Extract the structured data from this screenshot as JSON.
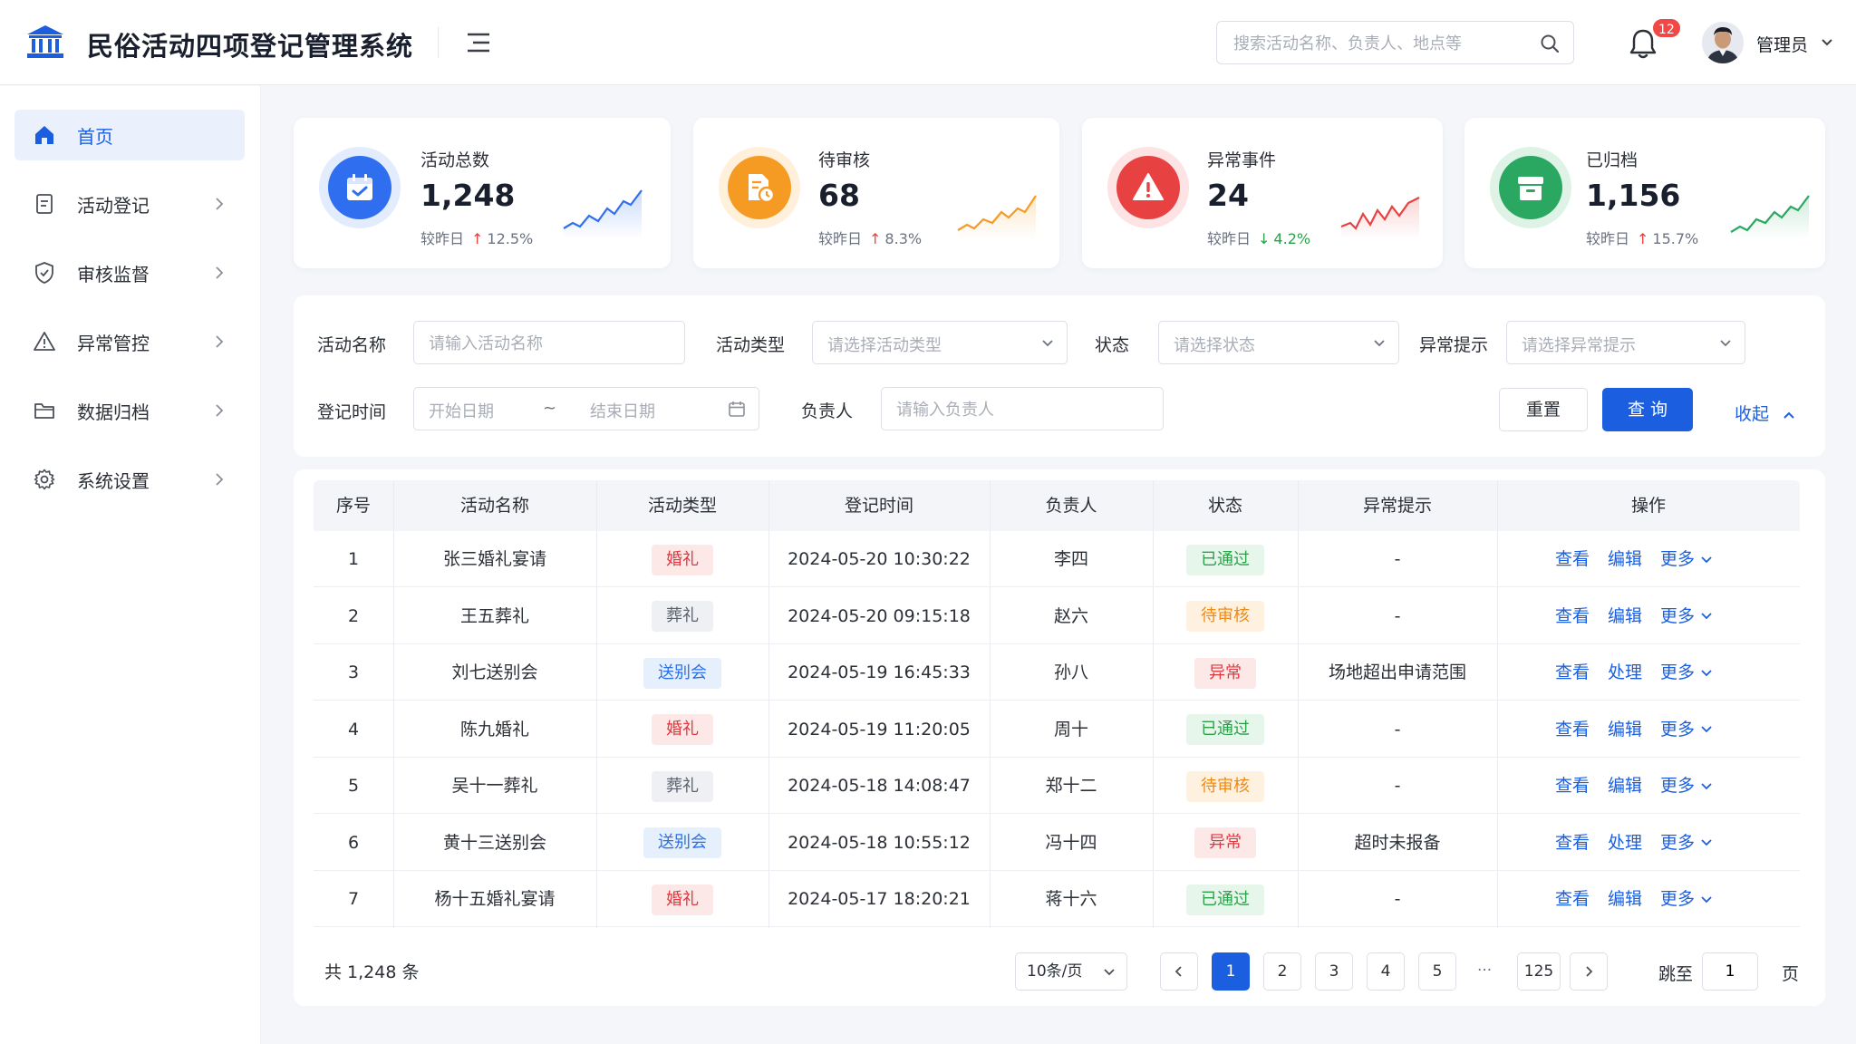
{
  "header": {
    "title": "民俗活动四项登记管理系统",
    "search_placeholder": "搜索活动名称、负责人、地点等",
    "notification_count": "12",
    "user_name": "管理员"
  },
  "sidebar": {
    "items": [
      {
        "label": "首页",
        "icon": "home-icon",
        "active": true
      },
      {
        "label": "活动登记",
        "icon": "register-icon"
      },
      {
        "label": "审核监督",
        "icon": "shield-icon"
      },
      {
        "label": "异常管控",
        "icon": "warning-icon"
      },
      {
        "label": "数据归档",
        "icon": "folder-icon"
      },
      {
        "label": "系统设置",
        "icon": "gear-icon"
      }
    ]
  },
  "stats": [
    {
      "title": "活动总数",
      "value": "1,248",
      "compare_label": "较昨日",
      "direction": "up",
      "change": "12.5%",
      "color": "#2f6fef",
      "icon": "calendar-check-icon"
    },
    {
      "title": "待审核",
      "value": "68",
      "compare_label": "较昨日",
      "direction": "up",
      "change": "8.3%",
      "color": "#f59b23",
      "icon": "document-clock-icon"
    },
    {
      "title": "异常事件",
      "value": "24",
      "compare_label": "较昨日",
      "direction": "down",
      "change": "4.2%",
      "color": "#e84141",
      "icon": "alert-triangle-icon"
    },
    {
      "title": "已归档",
      "value": "1,156",
      "compare_label": "较昨日",
      "direction": "up",
      "change": "15.7%",
      "color": "#2aa861",
      "icon": "archive-box-icon"
    }
  ],
  "filters": {
    "name_label": "活动名称",
    "name_placeholder": "请输入活动名称",
    "type_label": "活动类型",
    "type_placeholder": "请选择活动类型",
    "status_label": "状态",
    "status_placeholder": "请选择状态",
    "alert_label": "异常提示",
    "alert_placeholder": "请选择异常提示",
    "time_label": "登记时间",
    "start_placeholder": "开始日期",
    "range_sep": "~",
    "end_placeholder": "结束日期",
    "owner_label": "负责人",
    "owner_placeholder": "请输入负责人",
    "reset": "重置",
    "query": "查 询",
    "collapse": "收起"
  },
  "table": {
    "headers": [
      "序号",
      "活动名称",
      "活动类型",
      "登记时间",
      "负责人",
      "状态",
      "异常提示",
      "操作"
    ],
    "rows": [
      {
        "no": "1",
        "name": "张三婚礼宴请",
        "type": "婚礼",
        "type_style": "red",
        "time": "2024-05-20  10:30:22",
        "owner": "李四",
        "status": "已通过",
        "status_style": "green",
        "alert": "-",
        "act1": "查看",
        "act2": "编辑",
        "act3": "更多"
      },
      {
        "no": "2",
        "name": "王五葬礼",
        "type": "葬礼",
        "type_style": "gray",
        "time": "2024-05-20  09:15:18",
        "owner": "赵六",
        "status": "待审核",
        "status_style": "orange",
        "alert": "-",
        "act1": "查看",
        "act2": "编辑",
        "act3": "更多"
      },
      {
        "no": "3",
        "name": "刘七送别会",
        "type": "送别会",
        "type_style": "blue",
        "time": "2024-05-19  16:45:33",
        "owner": "孙八",
        "status": "异常",
        "status_style": "red",
        "alert": "场地超出申请范围",
        "act1": "查看",
        "act2": "处理",
        "act3": "更多"
      },
      {
        "no": "4",
        "name": "陈九婚礼",
        "type": "婚礼",
        "type_style": "red",
        "time": "2024-05-19  11:20:05",
        "owner": "周十",
        "status": "已通过",
        "status_style": "green",
        "alert": "-",
        "act1": "查看",
        "act2": "编辑",
        "act3": "更多"
      },
      {
        "no": "5",
        "name": "吴十一葬礼",
        "type": "葬礼",
        "type_style": "gray",
        "time": "2024-05-18  14:08:47",
        "owner": "郑十二",
        "status": "待审核",
        "status_style": "orange",
        "alert": "-",
        "act1": "查看",
        "act2": "编辑",
        "act3": "更多"
      },
      {
        "no": "6",
        "name": "黄十三送别会",
        "type": "送别会",
        "type_style": "blue",
        "time": "2024-05-18  10:55:12",
        "owner": "冯十四",
        "status": "异常",
        "status_style": "red",
        "alert": "超时未报备",
        "act1": "查看",
        "act2": "处理",
        "act3": "更多"
      },
      {
        "no": "7",
        "name": "杨十五婚礼宴请",
        "type": "婚礼",
        "type_style": "red",
        "time": "2024-05-17  18:20:21",
        "owner": "蒋十六",
        "status": "已通过",
        "status_style": "green",
        "alert": "-",
        "act1": "查看",
        "act2": "编辑",
        "act3": "更多"
      }
    ]
  },
  "pagination": {
    "total": "共 1,248 条",
    "page_size": "10条/页",
    "pages": [
      "1",
      "2",
      "3",
      "4",
      "5"
    ],
    "ellipsis": "···",
    "last_page": "125",
    "current": "1",
    "jump_label": "跳至",
    "jump_value": "1",
    "page_suffix": "页"
  }
}
